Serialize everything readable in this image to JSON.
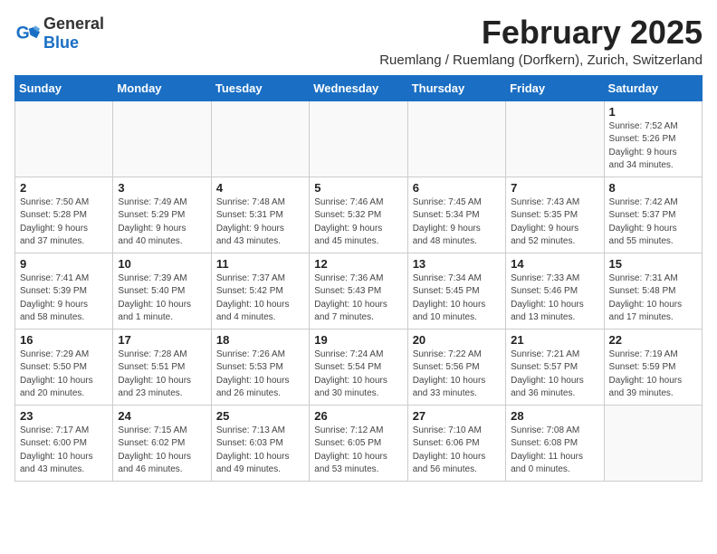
{
  "header": {
    "logo_general": "General",
    "logo_blue": "Blue",
    "title": "February 2025",
    "subtitle": "Ruemlang / Ruemlang (Dorfkern), Zurich, Switzerland"
  },
  "days_of_week": [
    "Sunday",
    "Monday",
    "Tuesday",
    "Wednesday",
    "Thursday",
    "Friday",
    "Saturday"
  ],
  "weeks": [
    [
      {
        "day": "",
        "info": ""
      },
      {
        "day": "",
        "info": ""
      },
      {
        "day": "",
        "info": ""
      },
      {
        "day": "",
        "info": ""
      },
      {
        "day": "",
        "info": ""
      },
      {
        "day": "",
        "info": ""
      },
      {
        "day": "1",
        "info": "Sunrise: 7:52 AM\nSunset: 5:26 PM\nDaylight: 9 hours\nand 34 minutes."
      }
    ],
    [
      {
        "day": "2",
        "info": "Sunrise: 7:50 AM\nSunset: 5:28 PM\nDaylight: 9 hours\nand 37 minutes."
      },
      {
        "day": "3",
        "info": "Sunrise: 7:49 AM\nSunset: 5:29 PM\nDaylight: 9 hours\nand 40 minutes."
      },
      {
        "day": "4",
        "info": "Sunrise: 7:48 AM\nSunset: 5:31 PM\nDaylight: 9 hours\nand 43 minutes."
      },
      {
        "day": "5",
        "info": "Sunrise: 7:46 AM\nSunset: 5:32 PM\nDaylight: 9 hours\nand 45 minutes."
      },
      {
        "day": "6",
        "info": "Sunrise: 7:45 AM\nSunset: 5:34 PM\nDaylight: 9 hours\nand 48 minutes."
      },
      {
        "day": "7",
        "info": "Sunrise: 7:43 AM\nSunset: 5:35 PM\nDaylight: 9 hours\nand 52 minutes."
      },
      {
        "day": "8",
        "info": "Sunrise: 7:42 AM\nSunset: 5:37 PM\nDaylight: 9 hours\nand 55 minutes."
      }
    ],
    [
      {
        "day": "9",
        "info": "Sunrise: 7:41 AM\nSunset: 5:39 PM\nDaylight: 9 hours\nand 58 minutes."
      },
      {
        "day": "10",
        "info": "Sunrise: 7:39 AM\nSunset: 5:40 PM\nDaylight: 10 hours\nand 1 minute."
      },
      {
        "day": "11",
        "info": "Sunrise: 7:37 AM\nSunset: 5:42 PM\nDaylight: 10 hours\nand 4 minutes."
      },
      {
        "day": "12",
        "info": "Sunrise: 7:36 AM\nSunset: 5:43 PM\nDaylight: 10 hours\nand 7 minutes."
      },
      {
        "day": "13",
        "info": "Sunrise: 7:34 AM\nSunset: 5:45 PM\nDaylight: 10 hours\nand 10 minutes."
      },
      {
        "day": "14",
        "info": "Sunrise: 7:33 AM\nSunset: 5:46 PM\nDaylight: 10 hours\nand 13 minutes."
      },
      {
        "day": "15",
        "info": "Sunrise: 7:31 AM\nSunset: 5:48 PM\nDaylight: 10 hours\nand 17 minutes."
      }
    ],
    [
      {
        "day": "16",
        "info": "Sunrise: 7:29 AM\nSunset: 5:50 PM\nDaylight: 10 hours\nand 20 minutes."
      },
      {
        "day": "17",
        "info": "Sunrise: 7:28 AM\nSunset: 5:51 PM\nDaylight: 10 hours\nand 23 minutes."
      },
      {
        "day": "18",
        "info": "Sunrise: 7:26 AM\nSunset: 5:53 PM\nDaylight: 10 hours\nand 26 minutes."
      },
      {
        "day": "19",
        "info": "Sunrise: 7:24 AM\nSunset: 5:54 PM\nDaylight: 10 hours\nand 30 minutes."
      },
      {
        "day": "20",
        "info": "Sunrise: 7:22 AM\nSunset: 5:56 PM\nDaylight: 10 hours\nand 33 minutes."
      },
      {
        "day": "21",
        "info": "Sunrise: 7:21 AM\nSunset: 5:57 PM\nDaylight: 10 hours\nand 36 minutes."
      },
      {
        "day": "22",
        "info": "Sunrise: 7:19 AM\nSunset: 5:59 PM\nDaylight: 10 hours\nand 39 minutes."
      }
    ],
    [
      {
        "day": "23",
        "info": "Sunrise: 7:17 AM\nSunset: 6:00 PM\nDaylight: 10 hours\nand 43 minutes."
      },
      {
        "day": "24",
        "info": "Sunrise: 7:15 AM\nSunset: 6:02 PM\nDaylight: 10 hours\nand 46 minutes."
      },
      {
        "day": "25",
        "info": "Sunrise: 7:13 AM\nSunset: 6:03 PM\nDaylight: 10 hours\nand 49 minutes."
      },
      {
        "day": "26",
        "info": "Sunrise: 7:12 AM\nSunset: 6:05 PM\nDaylight: 10 hours\nand 53 minutes."
      },
      {
        "day": "27",
        "info": "Sunrise: 7:10 AM\nSunset: 6:06 PM\nDaylight: 10 hours\nand 56 minutes."
      },
      {
        "day": "28",
        "info": "Sunrise: 7:08 AM\nSunset: 6:08 PM\nDaylight: 11 hours\nand 0 minutes."
      },
      {
        "day": "",
        "info": ""
      }
    ]
  ]
}
